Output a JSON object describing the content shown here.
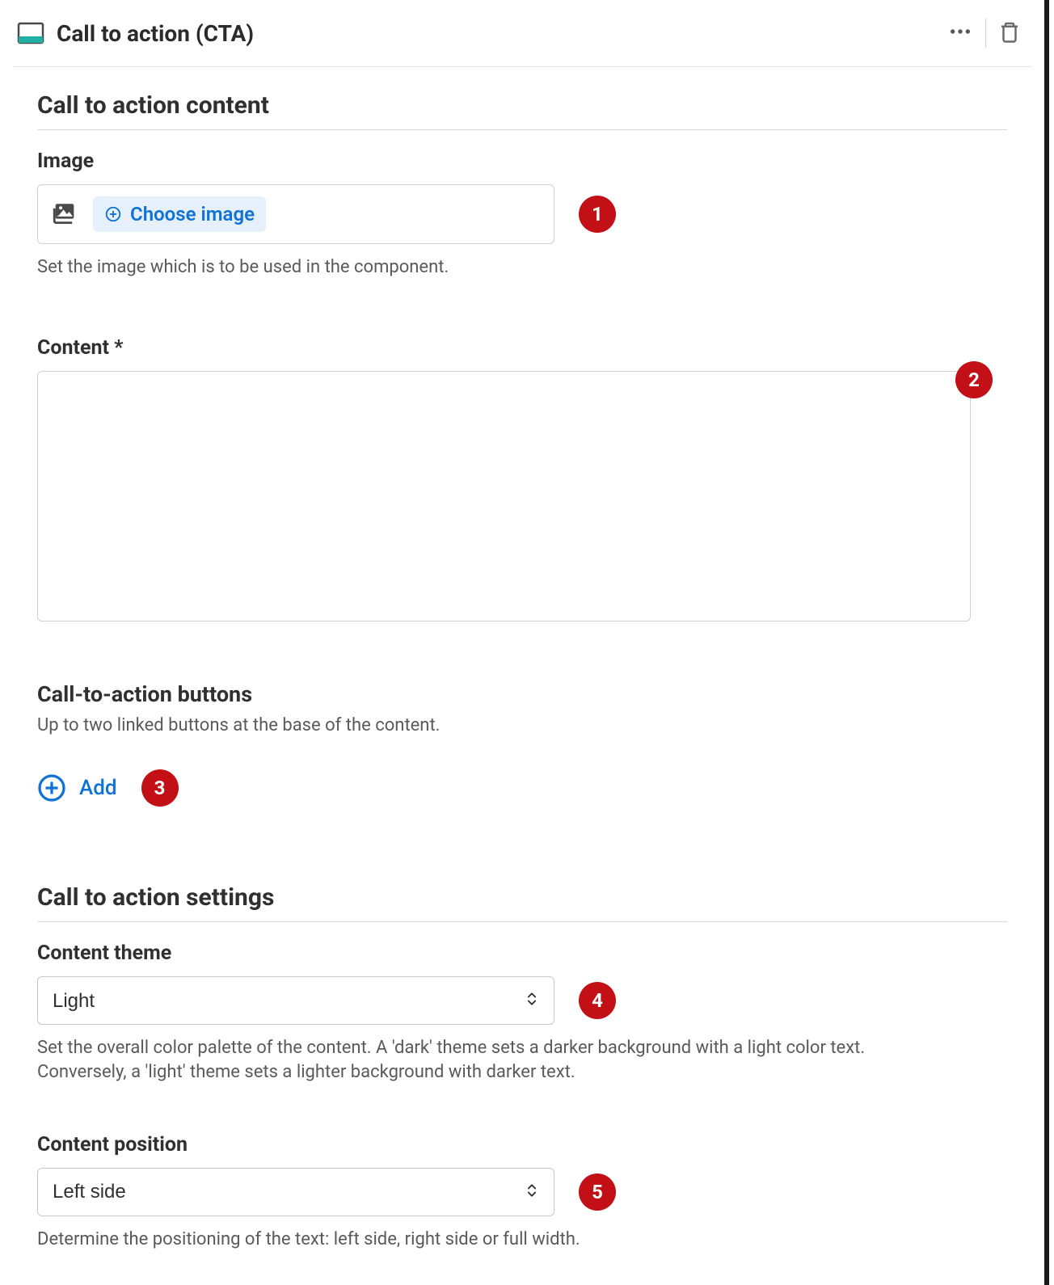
{
  "header": {
    "title": "Call to action (CTA)"
  },
  "section_content": {
    "title": "Call to action content",
    "image_field": {
      "label": "Image",
      "choose_label": "Choose image",
      "help": "Set the image which is to be used in the component."
    },
    "content_field": {
      "label": "Content *",
      "value": ""
    }
  },
  "section_buttons": {
    "title": "Call-to-action buttons",
    "help": "Up to two linked buttons at the base of the content.",
    "add_label": "Add"
  },
  "section_settings": {
    "title": "Call to action settings",
    "theme_field": {
      "label": "Content theme",
      "value": "Light",
      "help": "Set the overall color palette of the content. A 'dark' theme sets a darker background with a light color text. Conversely, a 'light' theme sets a lighter background with darker text."
    },
    "position_field": {
      "label": "Content position",
      "value": "Left side",
      "help": "Determine the positioning of the text: left side, right side or full width."
    }
  },
  "annotations": {
    "b1": "1",
    "b2": "2",
    "b3": "3",
    "b4": "4",
    "b5": "5"
  }
}
